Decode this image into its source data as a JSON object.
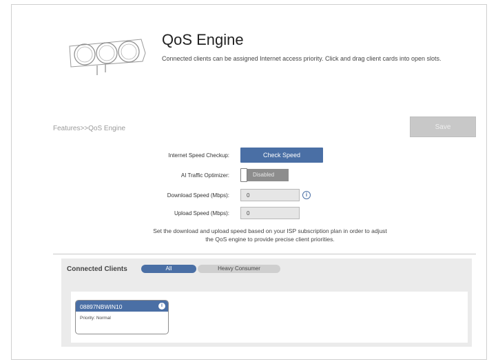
{
  "header": {
    "title": "QoS Engine",
    "description": "Connected clients can be assigned Internet access priority. Click and drag client cards into open slots."
  },
  "breadcrumb": "Features>>QoS Engine",
  "save_label": "Save",
  "form": {
    "speed_checkup_label": "Internet Speed Checkup:",
    "check_speed_label": "Check Speed",
    "ai_optimizer_label": "AI Traffic Optimizer:",
    "ai_optimizer_state": "Disabled",
    "download_label": "Download Speed (Mbps):",
    "download_value": "0",
    "upload_label": "Upload Speed (Mbps):",
    "upload_value": "0",
    "help_line1": "Set the download and upload speed based on your ISP subscription plan in order to adjust",
    "help_line2": "the QoS engine to provide precise client priorities."
  },
  "clients": {
    "title": "Connected Clients",
    "filters": [
      "All",
      "Heavy Consumer"
    ],
    "cards": [
      {
        "name": "08897NBWIN10",
        "priority": "Priority: Normal"
      }
    ]
  },
  "colors": {
    "accent": "#4a6fa5",
    "disabled": "#8d8d8d",
    "panel": "#ebebeb"
  },
  "icons": {
    "hero": "router-lights-icon",
    "info": "info-icon"
  }
}
